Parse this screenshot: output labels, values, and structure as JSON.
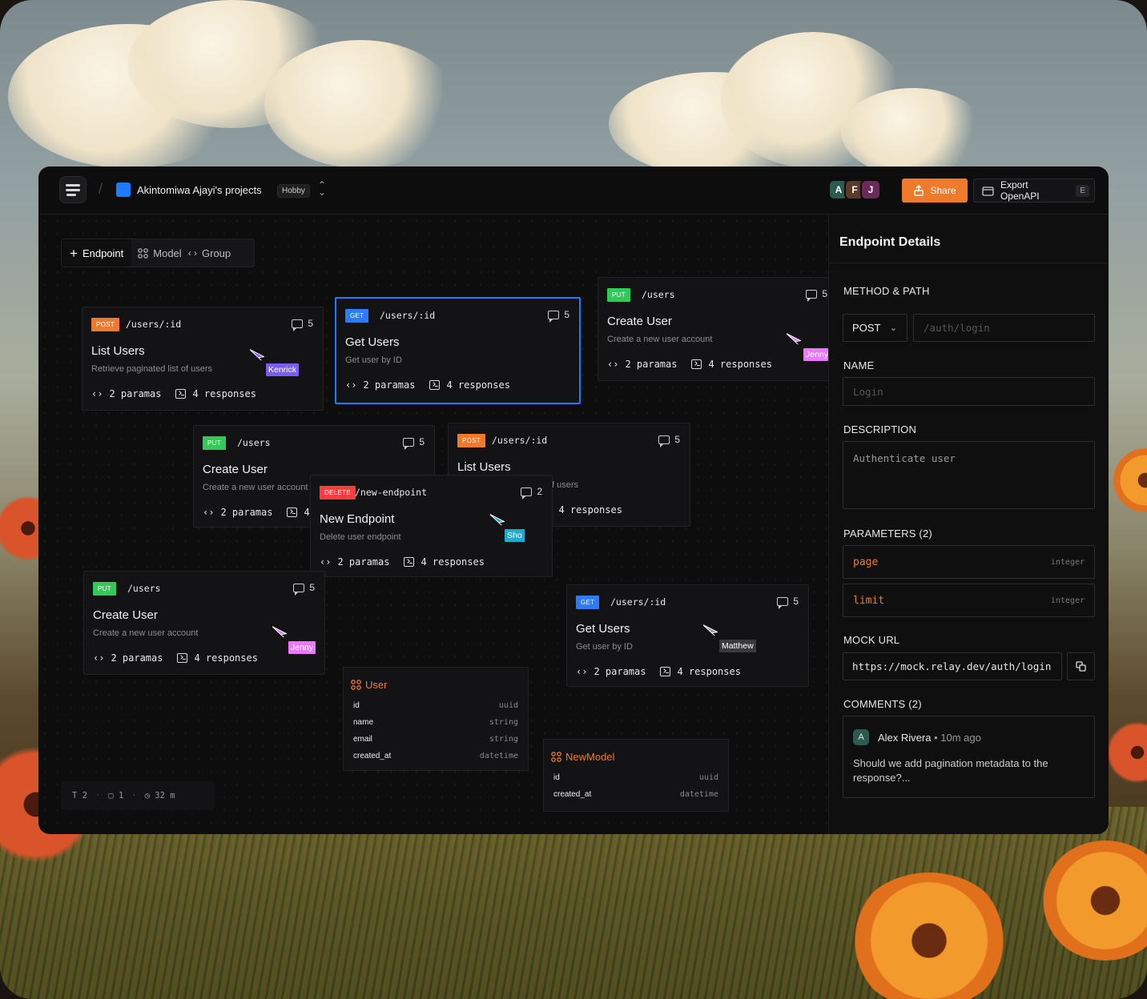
{
  "topbar": {
    "project_name": "Akintomiwa Ajayi's projects",
    "plan_badge": "Hobby",
    "avatars": [
      {
        "letter": "A",
        "color": "#2d5a4e"
      },
      {
        "letter": "F",
        "color": "#5a3a2a"
      },
      {
        "letter": "J",
        "color": "#6a2a5a"
      }
    ],
    "share_label": "Share",
    "export_label": "Export OpenAPI",
    "export_shortcut": "E",
    "accent": "#f07a2c"
  },
  "toolbar": {
    "endpoint_label": "Endpoint",
    "model_label": "Model",
    "group_label": "Group"
  },
  "cards": [
    {
      "method": "POST",
      "path": "/users/:id",
      "comments": "5",
      "title": "List Users",
      "desc": "Retrieve paginated list of users",
      "params": "2 paramas",
      "responses": "4 responses"
    },
    {
      "method": "GET",
      "path": "/users/:id",
      "comments": "5",
      "title": "Get Users",
      "desc": "Get user by ID",
      "params": "2 paramas",
      "responses": "4 responses"
    },
    {
      "method": "PUT",
      "path": "/users",
      "comments": "5",
      "title": "Create User",
      "desc": "Create a new user account",
      "params": "2 paramas",
      "responses": "4 responses"
    },
    {
      "method": "PUT",
      "path": "/users",
      "comments": "5",
      "title": "Create User",
      "desc": "Create a new user account",
      "params": "2 paramas",
      "responses": "4 responses"
    },
    {
      "method": "POST",
      "path": "/users/:id",
      "comments": "5",
      "title": "List Users",
      "desc": "Retrieve paginated list of users",
      "params": "2 paramas",
      "responses": "4 responses"
    },
    {
      "method": "DELETE",
      "path": "/new-endpoint",
      "comments": "2",
      "title": "New Endpoint",
      "desc": "Delete user endpoint",
      "params": "2 paramas",
      "responses": "4 responses"
    },
    {
      "method": "PUT",
      "path": "/users",
      "comments": "5",
      "title": "Create User",
      "desc": "Create a new user account",
      "params": "2 paramas",
      "responses": "4 responses"
    },
    {
      "method": "GET",
      "path": "/users/:id",
      "comments": "5",
      "title": "Get Users",
      "desc": "Get user by ID",
      "params": "2 paramas",
      "responses": "4 responses"
    }
  ],
  "cursors": [
    {
      "name": "Kenrick",
      "color": "#7b5cf0"
    },
    {
      "name": "Jenny",
      "color": "#e879f9"
    },
    {
      "name": "Sho",
      "color": "#22aacc"
    },
    {
      "name": "Jenny",
      "color": "#e879f9"
    },
    {
      "name": "Matthew",
      "color": "#3a3a3c"
    }
  ],
  "models": [
    {
      "name": "User",
      "fields": [
        {
          "name": "id",
          "type": "uuid"
        },
        {
          "name": "name",
          "type": "string"
        },
        {
          "name": "email",
          "type": "string"
        },
        {
          "name": "created_at",
          "type": "datetime"
        }
      ]
    },
    {
      "name": "NewModel",
      "fields": [
        {
          "name": "id",
          "type": "uuid"
        },
        {
          "name": "created_at",
          "type": "datetime"
        }
      ]
    }
  ],
  "status": {
    "endpoints": "2",
    "models": "1",
    "time": "32 m"
  },
  "panel": {
    "title": "Endpoint Details",
    "method_path_label": "METHOD & PATH",
    "method": "POST",
    "path_placeholder": "/auth/login",
    "name_label": "NAME",
    "name_placeholder": "Login",
    "description_label": "DESCRIPTION",
    "description_placeholder": "Authenticate user",
    "parameters_label": "PARAMETERS (2)",
    "parameters": [
      {
        "name": "page",
        "type": "integer"
      },
      {
        "name": "limit",
        "type": "integer"
      }
    ],
    "mock_url_label": "MOCK URL",
    "mock_url": "https://mock.relay.dev/auth/login",
    "comments_label": "COMMENTS (2)",
    "comment": {
      "avatar": "A",
      "author": "Alex Rivera",
      "time": "10m ago",
      "text": "Should we add pagination metadata to the response?..."
    }
  }
}
